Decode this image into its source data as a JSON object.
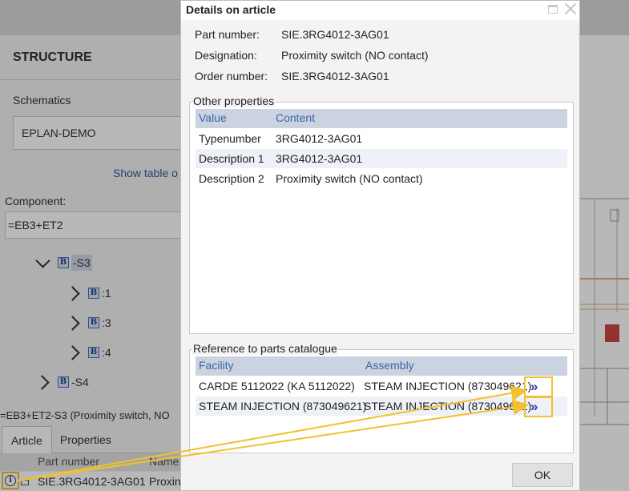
{
  "background": {
    "structure_title": "STRUCTURE",
    "schematics_label": "Schematics",
    "schematics_value": "EPLAN-DEMO",
    "show_table_link": "Show table o",
    "component_label": "Component:",
    "component_value": "=EB3+ET2",
    "tree": [
      {
        "label": "-S3",
        "expanded": true
      },
      {
        "label": ":1"
      },
      {
        "label": ":3"
      },
      {
        "label": ":4"
      },
      {
        "label": "-S4"
      }
    ],
    "status_line": "=EB3+ET2-S3 (Proximity switch, NO",
    "tabs": [
      "Article",
      "Properties"
    ],
    "table_headers": [
      "Part number",
      "Name"
    ],
    "table_row": {
      "part_number": "SIE.3RG4012-3AG01",
      "name": "Proxin"
    }
  },
  "dialog": {
    "title": "Details on article",
    "fields": {
      "part_number_label": "Part number:",
      "part_number_value": "SIE.3RG4012-3AG01",
      "designation_label": "Designation:",
      "designation_value": "Proximity switch (NO contact)",
      "order_number_label": "Order number:",
      "order_number_value": "SIE.3RG4012-3AG01"
    },
    "other_properties": {
      "legend": "Other properties",
      "headers": [
        "Value",
        "Content"
      ],
      "rows": [
        {
          "value": "Typenumber",
          "content": "3RG4012-3AG01"
        },
        {
          "value": "Description 1",
          "content": "3RG4012-3AG01"
        },
        {
          "value": "Description 2",
          "content": "Proximity switch (NO contact)"
        }
      ]
    },
    "parts_catalogue": {
      "legend": "Reference to parts catalogue",
      "headers": [
        "Facility",
        "Assembly"
      ],
      "rows": [
        {
          "facility": "CARDE 5112022 (KA 5112022)",
          "assembly": "STEAM INJECTION (873049621)",
          "goto": "»"
        },
        {
          "facility": "STEAM INJECTION (873049621)",
          "assembly": "STEAM INJECTION (873049621)",
          "goto": "»"
        }
      ]
    },
    "ok_label": "OK"
  },
  "colors": {
    "highlight": "#f2c12e",
    "grid_header": "#ccd3e0",
    "link_blue": "#2b5d9b"
  }
}
